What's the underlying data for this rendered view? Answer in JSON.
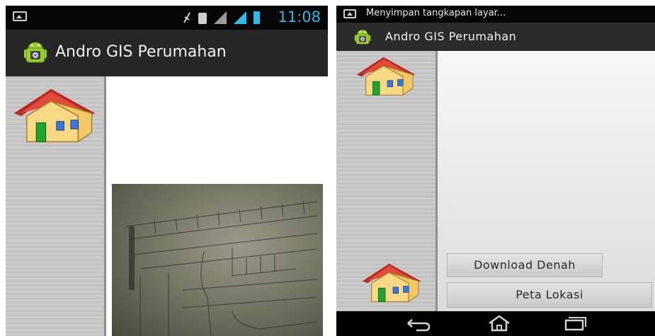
{
  "colors": {
    "status_accent": "#33b5e5",
    "actionbar_bg": "#262626",
    "roof": "#d63a2e",
    "wall": "#f5d27a",
    "door": "#1f9a2c"
  },
  "left_screen": {
    "status": {
      "time": "11:08"
    },
    "app": {
      "title": "Andro GIS Perumahan",
      "icon": "android-icon"
    },
    "sidebar": {
      "icons": [
        "house-icon"
      ]
    },
    "content": {
      "image": "site-plan-photo"
    }
  },
  "right_screen": {
    "status": {
      "notification_text": "Menyimpan tangkapan layar..."
    },
    "app": {
      "title": "Andro GIS Perumahan",
      "icon": "android-icon"
    },
    "sidebar": {
      "icons": [
        "house-icon",
        "house-icon"
      ]
    },
    "buttons": {
      "download": "Download Denah",
      "map": "Peta Lokasi"
    },
    "navbar": [
      "back-icon",
      "home-icon",
      "recent-apps-icon"
    ]
  }
}
